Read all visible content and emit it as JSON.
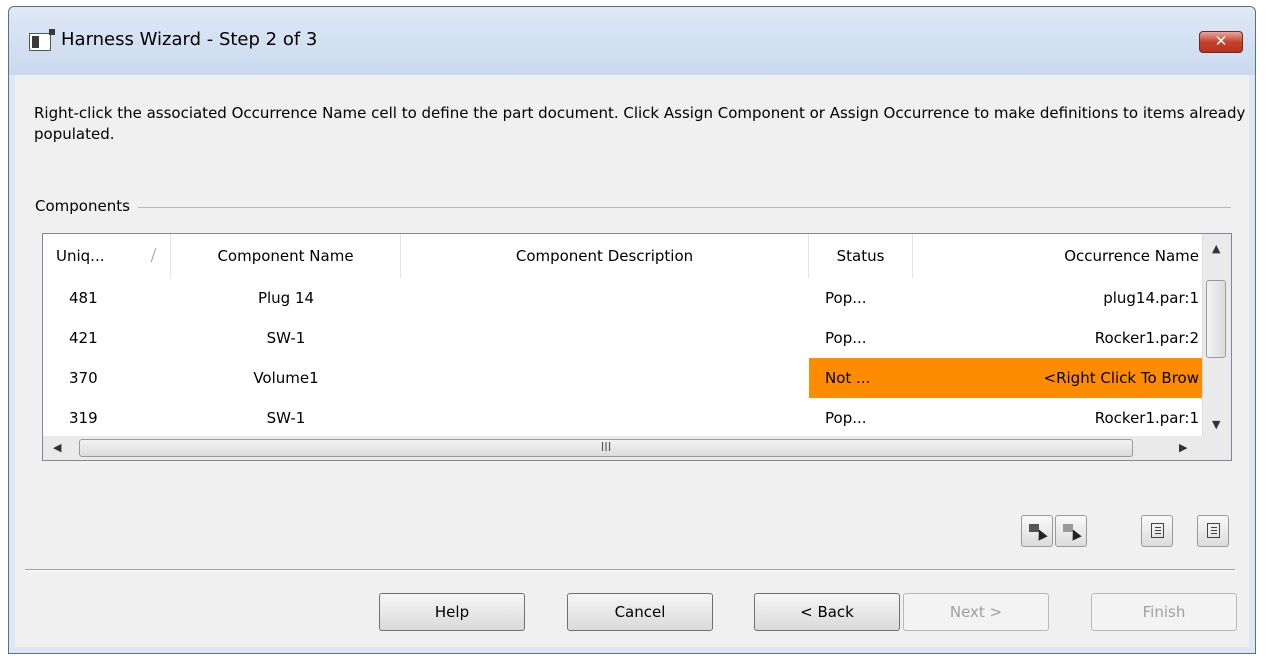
{
  "window": {
    "title": "Harness Wizard - Step 2 of 3",
    "close_label": "✕"
  },
  "instructions": "Right-click the associated Occurrence Name cell to define the part document.  Click Assign Component or Assign Occurrence to make definitions to items already populated.",
  "components_group_label": "Components",
  "grid": {
    "columns": [
      "Uniq...",
      "Component Name",
      "Component Description",
      "Status",
      "Occurrence Name"
    ],
    "rows": [
      {
        "id": "481",
        "name": "Plug 14",
        "description": "",
        "status": "Pop...",
        "occurrence": "plug14.par:1",
        "highlight": false
      },
      {
        "id": "421",
        "name": "SW-1",
        "description": "",
        "status": "Pop...",
        "occurrence": "Rocker1.par:2",
        "highlight": false
      },
      {
        "id": "370",
        "name": "Volume1",
        "description": "",
        "status": "Not ...",
        "occurrence": "<Right Click To Brow",
        "highlight": true
      },
      {
        "id": "319",
        "name": "SW-1",
        "description": "",
        "status": "Pop...",
        "occurrence": "Rocker1.par:1",
        "highlight": false
      }
    ],
    "highlight_color": "#ff8c00",
    "hscroll_grip": "III"
  },
  "toolbar_icons": [
    "assign-component-icon",
    "assign-occurrence-icon",
    "list-view-icon",
    "details-view-icon"
  ],
  "buttons": {
    "help": "Help",
    "cancel": "Cancel",
    "back": "< Back",
    "next": "Next >",
    "finish": "Finish"
  }
}
